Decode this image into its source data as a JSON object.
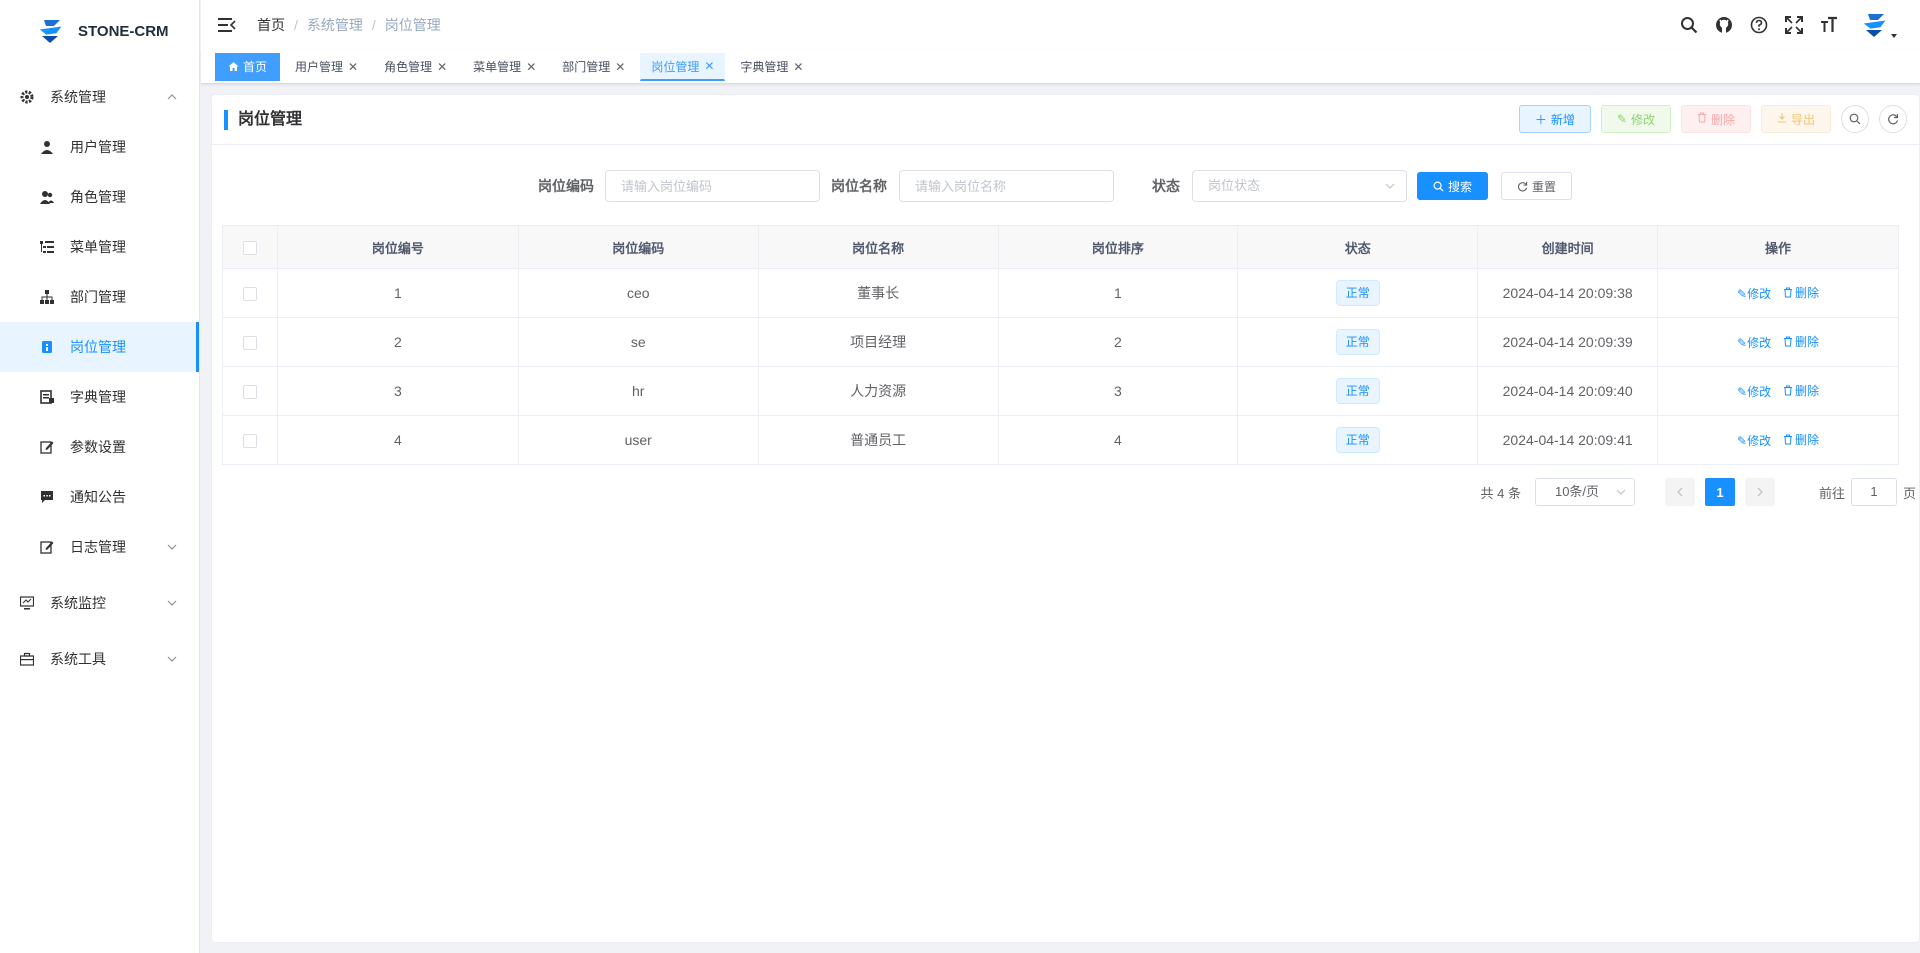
{
  "app": {
    "title": "STONE-CRM"
  },
  "colors": {
    "primary": "#1890ff",
    "success": "#67c23a",
    "danger": "#f56c6c",
    "warning": "#e6a23c"
  },
  "sidebar": {
    "groups": [
      {
        "label": "系统管理",
        "icon": "gear-icon",
        "expanded": true
      },
      {
        "label": "系统监控",
        "icon": "monitor-icon"
      },
      {
        "label": "系统工具",
        "icon": "toolbox-icon"
      }
    ],
    "items": [
      {
        "label": "用户管理",
        "icon": "user-icon"
      },
      {
        "label": "角色管理",
        "icon": "users-icon"
      },
      {
        "label": "菜单管理",
        "icon": "tree-table-icon"
      },
      {
        "label": "部门管理",
        "icon": "org-tree-icon"
      },
      {
        "label": "岗位管理",
        "icon": "post-icon",
        "active": true
      },
      {
        "label": "字典管理",
        "icon": "dict-icon"
      },
      {
        "label": "参数设置",
        "icon": "edit-icon"
      },
      {
        "label": "通知公告",
        "icon": "message-icon"
      },
      {
        "label": "日志管理",
        "icon": "log-icon"
      }
    ]
  },
  "header": {
    "breadcrumb": [
      "首页",
      "系统管理",
      "岗位管理"
    ]
  },
  "tags": [
    {
      "label": "首页",
      "home": true
    },
    {
      "label": "用户管理"
    },
    {
      "label": "角色管理"
    },
    {
      "label": "菜单管理"
    },
    {
      "label": "部门管理"
    },
    {
      "label": "岗位管理",
      "current": true
    },
    {
      "label": "字典管理"
    }
  ],
  "card": {
    "title": "岗位管理",
    "toolbar": {
      "add": "新增",
      "edit": "修改",
      "delete": "删除",
      "export": "导出"
    }
  },
  "search": {
    "code_label": "岗位编码",
    "code_placeholder": "请输入岗位编码",
    "name_label": "岗位名称",
    "name_placeholder": "请输入岗位名称",
    "status_label": "状态",
    "status_placeholder": "岗位状态",
    "search_btn": "搜索",
    "reset_btn": "重置"
  },
  "table": {
    "columns": [
      "岗位编号",
      "岗位编码",
      "岗位名称",
      "岗位排序",
      "状态",
      "创建时间",
      "操作"
    ],
    "rows": [
      {
        "id": "1",
        "code": "ceo",
        "name": "董事长",
        "sort": "1",
        "status": "正常",
        "created": "2024-04-14 20:09:38"
      },
      {
        "id": "2",
        "code": "se",
        "name": "项目经理",
        "sort": "2",
        "status": "正常",
        "created": "2024-04-14 20:09:39"
      },
      {
        "id": "3",
        "code": "hr",
        "name": "人力资源",
        "sort": "3",
        "status": "正常",
        "created": "2024-04-14 20:09:40"
      },
      {
        "id": "4",
        "code": "user",
        "name": "普通员工",
        "sort": "4",
        "status": "正常",
        "created": "2024-04-14 20:09:41"
      }
    ],
    "op_edit": "修改",
    "op_delete": "删除"
  },
  "pagination": {
    "total": "共 4 条",
    "page_size": "10条/页",
    "current": "1",
    "jump_label": "前往",
    "jump_value": "1",
    "jump_unit": "页"
  }
}
